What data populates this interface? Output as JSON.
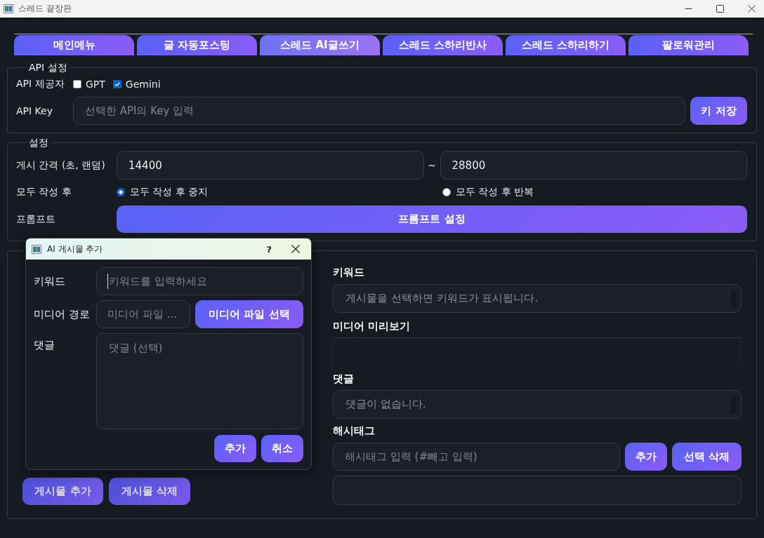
{
  "window": {
    "title": "스레드 끝장판"
  },
  "tabs": [
    {
      "label": "메인메뉴",
      "selected": false
    },
    {
      "label": "글 자동포스팅",
      "selected": false
    },
    {
      "label": "스레드 AI글쓰기",
      "selected": true
    },
    {
      "label": "스레드 스하리반사",
      "selected": false
    },
    {
      "label": "스레드 스하리하기",
      "selected": false
    },
    {
      "label": "팔로워관리",
      "selected": false
    }
  ],
  "api_settings": {
    "title": "API 설정",
    "provider_label": "API 제공자",
    "providers": [
      {
        "label": "GPT",
        "checked": false
      },
      {
        "label": "Gemini",
        "checked": true
      }
    ],
    "key_label": "API Key",
    "key_field": {
      "placeholder": "선택한 API의 Key 입력"
    },
    "save_button": "키 저장"
  },
  "settings": {
    "title": "설정",
    "interval_label": "게시 간격 (초, 랜덤)",
    "interval_min": {
      "value": "14400"
    },
    "interval_separator": "~",
    "interval_max": {
      "value": "28800"
    },
    "after_label": "모두 작성 후",
    "after_options": [
      {
        "label": "모두 작성 후 중지",
        "selected": true
      },
      {
        "label": "모두 작성 후 반복",
        "selected": false
      }
    ],
    "prompt_label": "프롬프트",
    "prompt_button": "프롬프트 설정"
  },
  "posts": {
    "buttons": [
      "게시물 추가",
      "게시물 삭제"
    ],
    "detail": {
      "keyword_label": "키워드",
      "keyword_field": {
        "placeholder": "게시물을 선택하면 키워드가 표시됩니다."
      },
      "media_label": "미디어 미리보기",
      "comment_label": "댓글",
      "comment_field": {
        "placeholder": "댓글이 없습니다."
      },
      "hashtag_label": "해시태그",
      "hashtag_field": {
        "placeholder": "해시태그 입력 (#빼고 입력)"
      },
      "hashtag_buttons": [
        "추가",
        "선택 삭제"
      ]
    }
  },
  "dialog": {
    "title": "AI 게시물 추가",
    "help": "?",
    "keyword_label": "키워드",
    "keyword_field": {
      "placeholder": "키워드를 입력하세요",
      "focused": true
    },
    "media_label": "미디어 경로",
    "media_field": {
      "placeholder": "미디어 파일 ..."
    },
    "media_button": "미디어 파일 선택",
    "comment_label": "댓글",
    "comment_field": {
      "placeholder": "댓글 (선택)"
    },
    "buttons": [
      "추가",
      "취소"
    ]
  }
}
